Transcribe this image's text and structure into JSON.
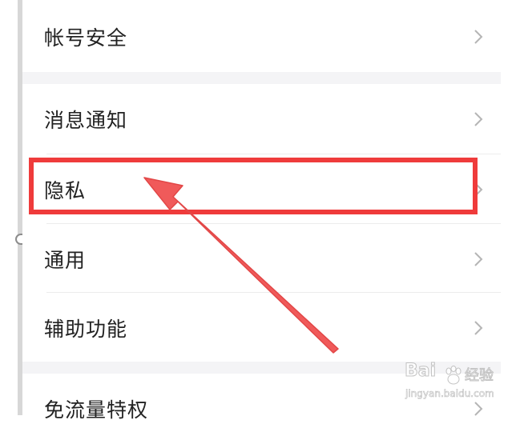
{
  "settings": {
    "items": [
      {
        "label": "帐号安全"
      },
      {
        "label": "消息通知"
      },
      {
        "label": "隐私"
      },
      {
        "label": "通用"
      },
      {
        "label": "辅助功能"
      },
      {
        "label": "免流量特权"
      }
    ]
  },
  "annotation": {
    "highlight_color": "#ef3b3b",
    "arrow_color": "#f05a5a",
    "highlighted_item": "隐私"
  },
  "watermark": {
    "brand": "Bai",
    "suffix": "经验",
    "url": "jingyan.baidu.com"
  },
  "icons": {
    "row_chevron": "chevron-right-icon",
    "watermark_logo": "baidu-paw-icon"
  }
}
